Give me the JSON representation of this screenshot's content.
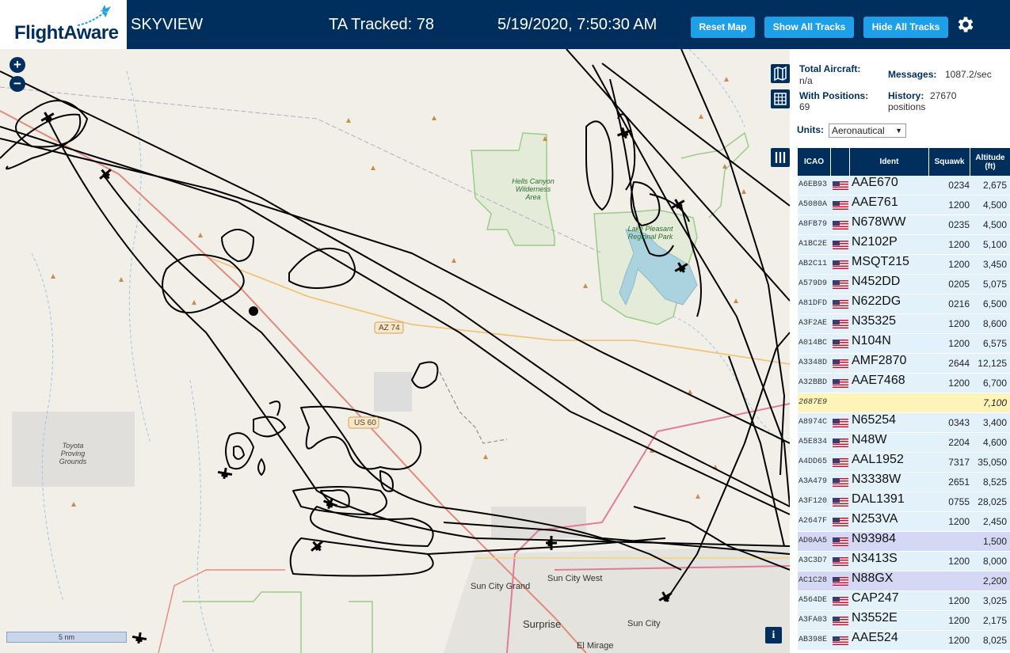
{
  "header": {
    "logo_text": "FlightAware",
    "app_title": "SKYVIEW",
    "tracked": "TA Tracked: 78",
    "datetime": "5/19/2020, 7:50:30 AM",
    "buttons": {
      "reset": "Reset Map",
      "show_all": "Show All Tracks",
      "hide_all": "Hide All Tracks"
    },
    "settings_icon": "gear-icon",
    "colors": {
      "bar": "#002f5d",
      "button": "#1ea0e8"
    }
  },
  "map": {
    "zoom_in": "+",
    "zoom_out": "−",
    "scale_label": "5 nm",
    "info_label": "i",
    "labels": {
      "hells_canyon": "Hells Canyon Wilderness Area",
      "lake_pleasant": "Lake Pleasant Regional Park",
      "toyota": "Toyota Proving Grounds",
      "az74": "AZ 74",
      "us60": "US 60",
      "sun_city_grand": "Sun City Grand",
      "sun_city_west": "Sun City West",
      "surprise": "Surprise",
      "sun_city": "Sun City",
      "el_mirage": "El Mirage"
    }
  },
  "stats": {
    "total_aircraft_label": "Total Aircraft:",
    "total_aircraft_value": "n/a",
    "with_positions_label": "With Positions:",
    "with_positions_value": "69",
    "messages_label": "Messages:",
    "messages_value": "1087.2/sec",
    "history_label": "History:",
    "history_value": "27670",
    "history_unit": "positions",
    "units_label": "Units:",
    "units_value": "Aeronautical"
  },
  "table": {
    "headers": {
      "icao": "ICAO",
      "ident": "Ident",
      "squawk": "Squawk",
      "altitude": "Altitude (ft)"
    },
    "row_colors": {
      "normal": "#e3f1fb",
      "no_position": "#fff4b8",
      "selected": "#d5d8f5"
    },
    "rows": [
      {
        "icao": "A6EB93",
        "ident": "AAE670",
        "squawk": "0234",
        "alt": "2,675",
        "state": "normal"
      },
      {
        "icao": "A5080A",
        "ident": "AAE761",
        "squawk": "1200",
        "alt": "4,500",
        "state": "normal"
      },
      {
        "icao": "A8FB79",
        "ident": "N678WW",
        "squawk": "0235",
        "alt": "4,500",
        "state": "normal"
      },
      {
        "icao": "A1BC2E",
        "ident": "N2102P",
        "squawk": "1200",
        "alt": "5,100",
        "state": "normal"
      },
      {
        "icao": "AB2C11",
        "ident": "MSQT215",
        "squawk": "1200",
        "alt": "3,450",
        "state": "normal"
      },
      {
        "icao": "A579D9",
        "ident": "N452DD",
        "squawk": "0205",
        "alt": "5,075",
        "state": "normal"
      },
      {
        "icao": "A81DFD",
        "ident": "N622DG",
        "squawk": "0216",
        "alt": "6,500",
        "state": "normal"
      },
      {
        "icao": "A3F2AE",
        "ident": "N35325",
        "squawk": "1200",
        "alt": "8,600",
        "state": "normal"
      },
      {
        "icao": "A014BC",
        "ident": "N104N",
        "squawk": "1200",
        "alt": "6,575",
        "state": "normal"
      },
      {
        "icao": "A3348D",
        "ident": "AMF2870",
        "squawk": "2644",
        "alt": "12,125",
        "state": "normal"
      },
      {
        "icao": "A32BBD",
        "ident": "AAE7468",
        "squawk": "1200",
        "alt": "6,700",
        "state": "normal"
      },
      {
        "icao": "2687E9",
        "ident": "",
        "squawk": "",
        "alt": "7,100",
        "state": "no_position"
      },
      {
        "icao": "A8974C",
        "ident": "N65254",
        "squawk": "0343",
        "alt": "3,400",
        "state": "normal"
      },
      {
        "icao": "A5E834",
        "ident": "N48W",
        "squawk": "2204",
        "alt": "4,600",
        "state": "normal"
      },
      {
        "icao": "A4DD65",
        "ident": "AAL1952",
        "squawk": "7317",
        "alt": "35,050",
        "state": "normal"
      },
      {
        "icao": "A3A479",
        "ident": "N3338W",
        "squawk": "2651",
        "alt": "8,525",
        "state": "normal"
      },
      {
        "icao": "A3F120",
        "ident": "DAL1391",
        "squawk": "0755",
        "alt": "28,025",
        "state": "normal"
      },
      {
        "icao": "A2647F",
        "ident": "N253VA",
        "squawk": "1200",
        "alt": "2,450",
        "state": "normal"
      },
      {
        "icao": "AD0AA5",
        "ident": "N93984",
        "squawk": "",
        "alt": "1,500",
        "state": "selected"
      },
      {
        "icao": "A3C3D7",
        "ident": "N3413S",
        "squawk": "1200",
        "alt": "8,000",
        "state": "normal"
      },
      {
        "icao": "AC1C28",
        "ident": "N88GX",
        "squawk": "",
        "alt": "2,200",
        "state": "selected"
      },
      {
        "icao": "A564DE",
        "ident": "CAP247",
        "squawk": "1200",
        "alt": "3,025",
        "state": "normal"
      },
      {
        "icao": "A3FA03",
        "ident": "N3552E",
        "squawk": "1200",
        "alt": "2,175",
        "state": "normal"
      },
      {
        "icao": "AB398E",
        "ident": "AAE524",
        "squawk": "1200",
        "alt": "8,025",
        "state": "normal"
      }
    ]
  }
}
